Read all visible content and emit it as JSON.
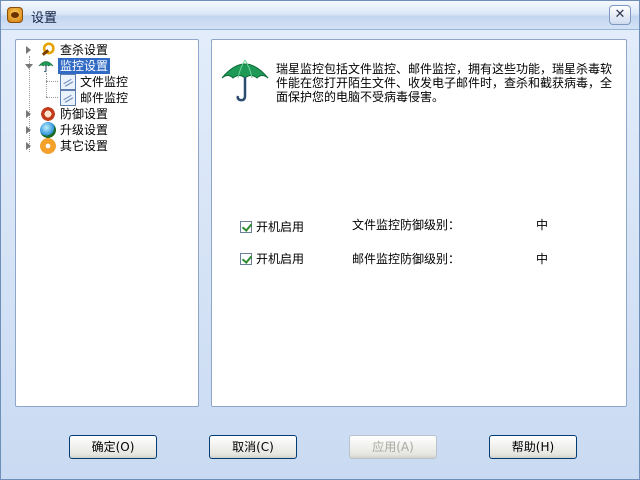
{
  "window": {
    "title": "设置"
  },
  "tree": [
    {
      "label": "查杀设置",
      "icon": "magnifier-icon"
    },
    {
      "label": "监控设置",
      "icon": "umbrella-icon",
      "selected": true
    },
    {
      "label": "文件监控",
      "icon": "document-icon"
    },
    {
      "label": "邮件监控",
      "icon": "document-icon"
    },
    {
      "label": "防御设置",
      "icon": "shield-icon"
    },
    {
      "label": "升级设置",
      "icon": "globe-icon"
    },
    {
      "label": "其它设置",
      "icon": "gear-icon"
    }
  ],
  "content": {
    "icon": "umbrella-icon",
    "description": "瑞星监控包括文件监控、邮件监控，拥有这些功能，瑞星杀毒软件能在您打开陌生文件、收发电子邮件时，查杀和截获病毒，全面保护您的电脑不受病毒侵害。",
    "rows": [
      {
        "checkbox_label": "开机启用",
        "checked": true,
        "level_label": "文件监控防御级别：",
        "level_value": "中"
      },
      {
        "checkbox_label": "开机启用",
        "checked": true,
        "level_label": "邮件监控防御级别：",
        "level_value": "中"
      }
    ]
  },
  "buttons": {
    "ok": "确定(O)",
    "cancel": "取消(C)",
    "apply": "应用(A)",
    "help": "帮助(H)"
  },
  "colors": {
    "selection": "#316ac5",
    "accent_green": "#2e8b2e"
  }
}
